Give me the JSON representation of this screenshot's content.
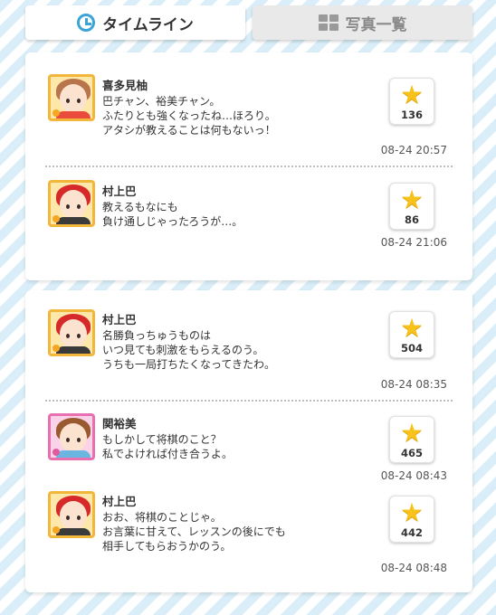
{
  "tabs": [
    {
      "label": "タイムライン",
      "icon": "clock-icon",
      "active": true
    },
    {
      "label": "写真一覧",
      "icon": "grid-icon",
      "active": false
    }
  ],
  "cards": [
    {
      "posts": [
        {
          "name": "喜多見柚",
          "message": "巴チャン、裕美チャン。\nふたりとも強くなったね…ほろり。\nアタシが教えることは何もないっ！",
          "likes": "136",
          "time": "08-24 20:57"
        },
        {
          "name": "村上巴",
          "message": "教えるもなにも\n負け通しじゃったろうが…。",
          "likes": "86",
          "time": "08-24 21:06"
        }
      ]
    },
    {
      "posts": [
        {
          "name": "村上巴",
          "message": "名勝負っちゅうものは\nいつ見ても刺激をもらえるのう。\nうちも一局打ちたくなってきたわ。",
          "likes": "504",
          "time": "08-24 08:35"
        },
        {
          "name": "関裕美",
          "message": "もしかして将棋のこと？\n私でよければ付き合うよ。",
          "likes": "465",
          "time": "08-24 08:43"
        },
        {
          "name": "村上巴",
          "message": "おお、将棋のことじゃ。\nお言葉に甘えて、レッスンの後にでも\n相手してもらおうかのう。",
          "likes": "442",
          "time": "08-24 08:48"
        }
      ]
    }
  ],
  "colors": {
    "accent": "#3aa4d8",
    "star": "#f7c21b",
    "avatar_border_yellow": "#f2b63b",
    "avatar_border_pink": "#e86fb0"
  }
}
